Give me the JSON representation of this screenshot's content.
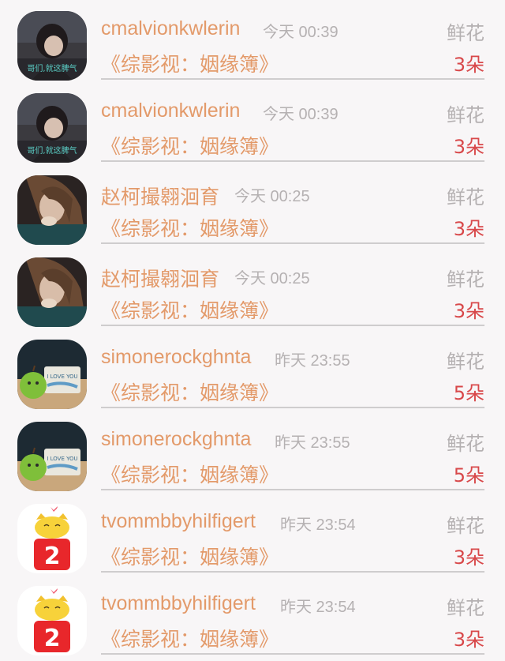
{
  "gift_list": {
    "items": [
      {
        "user": "cmalvionkwlerin",
        "time": "今天 00:39",
        "gift_type": "鲜花",
        "book": "《综影视：姻缘簿》",
        "quantity": "3朵",
        "avatar_icon": "boy-photo-avatar-icon",
        "avatar_text": "哥们,就这脾气"
      },
      {
        "user": "cmalvionkwlerin",
        "time": "今天 00:39",
        "gift_type": "鲜花",
        "book": "《综影视：姻缘簿》",
        "quantity": "3朵",
        "avatar_icon": "boy-photo-avatar-icon",
        "avatar_text": "哥们,就这脾气"
      },
      {
        "user": "赵柯撮翱洄育",
        "time": "今天 00:25",
        "gift_type": "鲜花",
        "book": "《综影视：姻缘簿》",
        "quantity": "3朵",
        "avatar_icon": "girl-photo-avatar-icon"
      },
      {
        "user": "赵柯撮翱洄育",
        "time": "今天 00:25",
        "gift_type": "鲜花",
        "book": "《综影视：姻缘簿》",
        "quantity": "3朵",
        "avatar_icon": "girl-photo-avatar-icon"
      },
      {
        "user": "simonerockghnta",
        "time": "昨天 23:55",
        "gift_type": "鲜花",
        "book": "《综影视：姻缘簿》",
        "quantity": "5朵",
        "avatar_icon": "apple-love-you-avatar-icon",
        "avatar_text": "I LOVE YOU"
      },
      {
        "user": "simonerockghnta",
        "time": "昨天 23:55",
        "gift_type": "鲜花",
        "book": "《综影视：姻缘簿》",
        "quantity": "5朵",
        "avatar_icon": "apple-love-you-avatar-icon",
        "avatar_text": "I LOVE YOU"
      },
      {
        "user": "tvommbbyhilfigert",
        "time": "昨天 23:54",
        "gift_type": "鲜花",
        "book": "《综影视：姻缘簿》",
        "quantity": "3朵",
        "avatar_icon": "cat-number-2-avatar-icon",
        "avatar_text": "2"
      },
      {
        "user": "tvommbbyhilfigert",
        "time": "昨天 23:54",
        "gift_type": "鲜花",
        "book": "《综影视：姻缘簿》",
        "quantity": "3朵",
        "avatar_icon": "cat-number-2-avatar-icon",
        "avatar_text": "2"
      }
    ]
  },
  "colors": {
    "username": "#e39a6a",
    "timestamp": "#b5b1b2",
    "quantity": "#d8484a",
    "divider": "#cfcdce",
    "background": "#f8f6f7"
  }
}
